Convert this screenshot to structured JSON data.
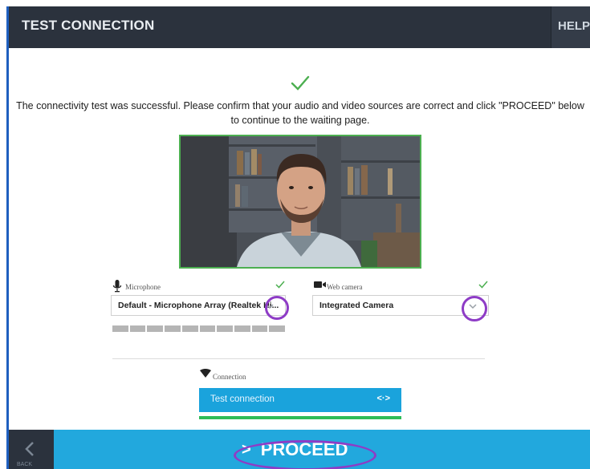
{
  "header": {
    "title": "TEST CONNECTION",
    "help_label": "HELP"
  },
  "message": "The connectivity test was successful. Please confirm that your audio and video sources are correct and click \"PROCEED\" below to continue to the waiting page.",
  "devices": {
    "microphone": {
      "label": "Microphone",
      "value": "Default - Microphone Array (Realtek Hi..."
    },
    "webcam": {
      "label": "Web camera",
      "value": "Integrated Camera"
    }
  },
  "connection": {
    "label": "Connection",
    "button_label": "Test connection",
    "button_icon": "<·>",
    "progress": 1.0
  },
  "footer": {
    "proceed_label": "PROCEED",
    "proceed_icon": ">",
    "back_label": "BACK"
  },
  "colors": {
    "header_bg": "#2b323d",
    "accent_blue": "#22a8dd",
    "success_green": "#4caf50",
    "highlight_purple": "#8e3cc6"
  },
  "icons": [
    "check-icon",
    "microphone-icon",
    "camera-icon",
    "wifi-icon",
    "chevron-down-icon",
    "chevron-left-icon"
  ]
}
